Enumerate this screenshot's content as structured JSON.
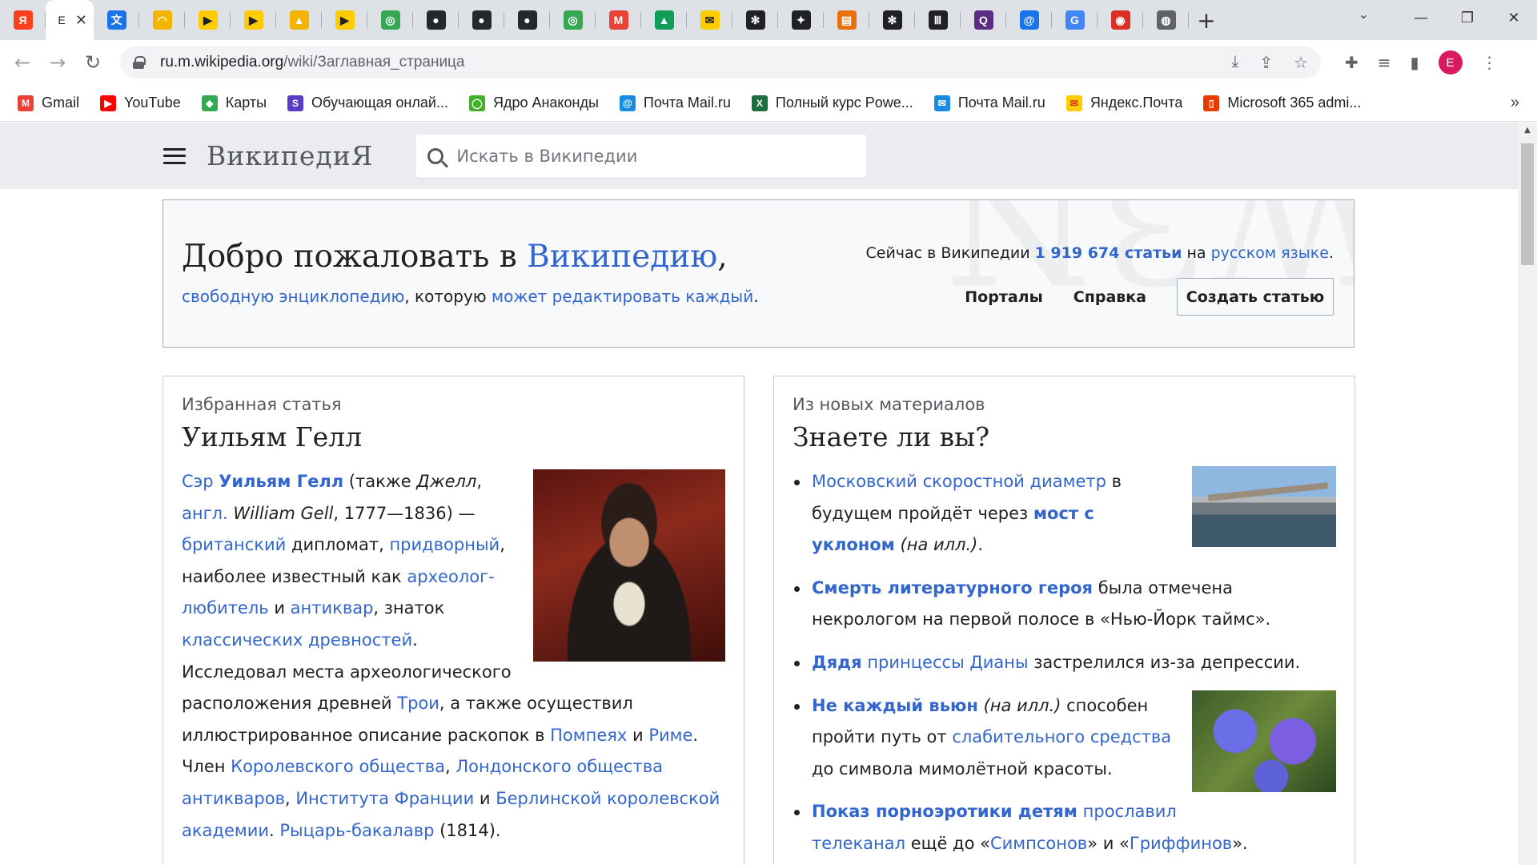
{
  "browser": {
    "active_tab_title": "Е",
    "tabs": [
      {
        "icon": "yandex-icon",
        "color": "#fc3f1d",
        "glyph": "Я"
      },
      {
        "icon": "wikipedia-icon",
        "color": "#ffffff",
        "glyph": "Е",
        "active": true
      },
      {
        "icon": "translate-icon",
        "color": "#1a73e8",
        "glyph": "文"
      },
      {
        "icon": "rainbow-icon",
        "color": "#f4b400",
        "glyph": "◠"
      },
      {
        "icon": "play-icon",
        "color": "#ffcc00",
        "glyph": "▶"
      },
      {
        "icon": "play-icon",
        "color": "#ffcc00",
        "glyph": "▶"
      },
      {
        "icon": "image-icon",
        "color": "#f4b400",
        "glyph": "▲"
      },
      {
        "icon": "play-icon",
        "color": "#ffcc00",
        "glyph": "▶"
      },
      {
        "icon": "spiral-icon",
        "color": "#34a853",
        "glyph": "◎"
      },
      {
        "icon": "github-icon",
        "color": "#24292e",
        "glyph": "●"
      },
      {
        "icon": "github-icon",
        "color": "#24292e",
        "glyph": "●"
      },
      {
        "icon": "github-icon",
        "color": "#24292e",
        "glyph": "●"
      },
      {
        "icon": "spiral-icon",
        "color": "#34a853",
        "glyph": "◎"
      },
      {
        "icon": "gmail-icon",
        "color": "#ea4335",
        "glyph": "M"
      },
      {
        "icon": "drive-icon",
        "color": "#0f9d58",
        "glyph": "▲"
      },
      {
        "icon": "mail-icon",
        "color": "#ffcc00",
        "glyph": "✉"
      },
      {
        "icon": "openai-icon",
        "color": "#202124",
        "glyph": "✻"
      },
      {
        "icon": "compass-icon",
        "color": "#202124",
        "glyph": "✦"
      },
      {
        "icon": "calendar-icon",
        "color": "#e8710a",
        "glyph": "▤"
      },
      {
        "icon": "openai-icon",
        "color": "#202124",
        "glyph": "✻"
      },
      {
        "icon": "library-icon",
        "color": "#202124",
        "glyph": "Ⅲ"
      },
      {
        "icon": "q-icon",
        "color": "#5a2d82",
        "glyph": "Q"
      },
      {
        "icon": "at-icon",
        "color": "#1a73e8",
        "glyph": "@"
      },
      {
        "icon": "google-icon",
        "color": "#4285f4",
        "glyph": "G"
      },
      {
        "icon": "color-wheel-icon",
        "color": "#d93025",
        "glyph": "◉"
      },
      {
        "icon": "globe-icon",
        "color": "#5f6368",
        "glyph": "◍"
      }
    ],
    "url_host": "ru.m.wikipedia.org",
    "url_path": "/wiki/Заглавная_страница",
    "avatar_letter": "E",
    "avatar_color": "#d81b60"
  },
  "bookmarks": [
    {
      "label": "Gmail",
      "icon": "gmail-icon",
      "color": "#ea4335",
      "glyph": "M"
    },
    {
      "label": "YouTube",
      "icon": "youtube-icon",
      "color": "#ff0000",
      "glyph": "▶"
    },
    {
      "label": "Карты",
      "icon": "maps-icon",
      "color": "#34a853",
      "glyph": "◆"
    },
    {
      "label": "Обучающая онлай...",
      "icon": "s-icon",
      "color": "#5b3cc4",
      "glyph": "S"
    },
    {
      "label": "Ядро Анаконды",
      "icon": "anaconda-icon",
      "color": "#43b02a",
      "glyph": "◯"
    },
    {
      "label": "Почта Mail.ru",
      "icon": "mailru-icon",
      "color": "#168de2",
      "glyph": "@"
    },
    {
      "label": "Полный курс Powe...",
      "icon": "excel-icon",
      "color": "#1d6f42",
      "glyph": "X"
    },
    {
      "label": "Почта Mail.ru",
      "icon": "mailru-icon",
      "color": "#168de2",
      "glyph": "✉"
    },
    {
      "label": "Яндекс.Почта",
      "icon": "yandex-mail-icon",
      "color": "#ffcc00",
      "glyph": "✉"
    },
    {
      "label": "Microsoft 365 admi...",
      "icon": "office-icon",
      "color": "#eb3c00",
      "glyph": "▯"
    }
  ],
  "wiki": {
    "logo": "ВикипедиЯ",
    "search_placeholder": "Искать в Википедии",
    "welcome": {
      "title_prefix": "Добро пожаловать в ",
      "title_link": "Википедию",
      "title_suffix": ",",
      "sub_link1": "свободную энциклопедию",
      "sub_text": ", которую ",
      "sub_link2": "может редактировать каждый",
      "sub_end": ".",
      "count_prefix": "Сейчас в Википедии ",
      "count_link": "1 919 674 статьи",
      "count_mid": " на ",
      "count_lang": "русском языке",
      "count_end": ".",
      "nav_portals": "Порталы",
      "nav_help": "Справка",
      "create_button": "Создать статью"
    },
    "featured": {
      "label": "Избранная статья",
      "title": "Уильям Гелл"
    },
    "dyk": {
      "label": "Из новых материалов",
      "title": "Знаете ли вы?"
    }
  }
}
